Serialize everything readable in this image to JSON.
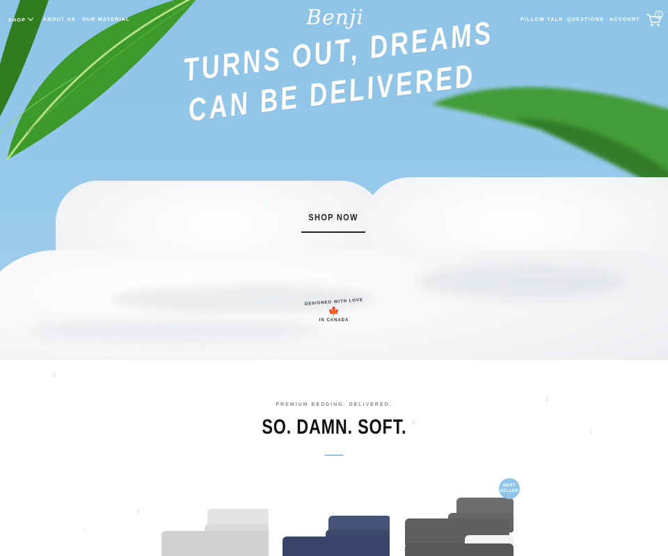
{
  "nav": {
    "shop": "SHOP",
    "about": "ABOUT US",
    "material": "OUR MATERIAL",
    "logo": "Benji",
    "pillow_talk": "PILLOW TALK",
    "questions": "QUESTIONS",
    "account": "ACCOUNT",
    "cart_count": "0"
  },
  "hero": {
    "headline_line1": "TURNS OUT, DREAMS",
    "headline_line2": "CAN BE DELIVERED",
    "cta": "SHOP NOW",
    "badge_top": "DESIGNED WITH LOVE",
    "badge_bottom": "IN CANADA"
  },
  "section": {
    "kicker": "PREMIUM BEDDING. DELIVERED.",
    "title": "SO. DAMN. SOFT."
  },
  "products": [
    {
      "color": "#d6d7d8"
    },
    {
      "color": "#3d4a66"
    },
    {
      "color": "#6b6b6b"
    }
  ],
  "best_seller": {
    "line1": "BEST",
    "line2": "SELLER"
  },
  "colors": {
    "accent": "#8ec4e8",
    "hero_sky": "#8ec4e8",
    "text": "#111111"
  }
}
